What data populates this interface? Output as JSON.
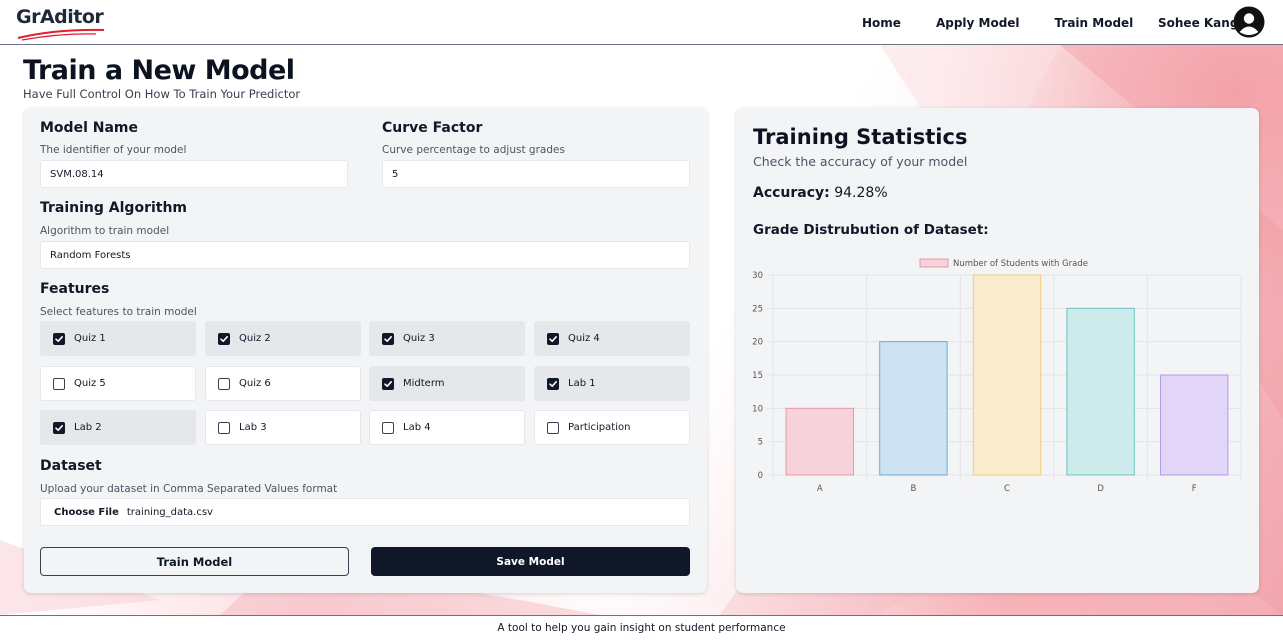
{
  "nav": {
    "logo_text": "GrAditor",
    "links": [
      "Home",
      "Apply Model",
      "Train Model"
    ],
    "user_name": "Sohee Kang"
  },
  "page": {
    "title": "Train a New Model",
    "subtitle": "Have Full Control On How To Train Your Predictor"
  },
  "form": {
    "model_name": {
      "label": "Model Name",
      "help": "The identifier of your model",
      "value": "SVM.08.14"
    },
    "curve_factor": {
      "label": "Curve Factor",
      "help": "Curve percentage to adjust grades",
      "value": "5"
    },
    "algorithm": {
      "label": "Training Algorithm",
      "help": "Algorithm to train model",
      "value": "Random Forests"
    },
    "features": {
      "label": "Features",
      "help": "Select features to train model",
      "items": [
        {
          "label": "Quiz 1",
          "checked": true
        },
        {
          "label": "Quiz 2",
          "checked": true
        },
        {
          "label": "Quiz 3",
          "checked": true
        },
        {
          "label": "Quiz 4",
          "checked": true
        },
        {
          "label": "Quiz 5",
          "checked": false
        },
        {
          "label": "Quiz 6",
          "checked": false
        },
        {
          "label": "Midterm",
          "checked": true
        },
        {
          "label": "Lab 1",
          "checked": true
        },
        {
          "label": "Lab 2",
          "checked": true
        },
        {
          "label": "Lab 3",
          "checked": false
        },
        {
          "label": "Lab 4",
          "checked": false
        },
        {
          "label": "Participation",
          "checked": false
        }
      ]
    },
    "dataset": {
      "label": "Dataset",
      "help": "Upload your dataset in Comma Separated Values format",
      "button": "Choose File",
      "file_name": "training_data.csv"
    },
    "train_button": "Train Model",
    "save_button": "Save Model"
  },
  "stats": {
    "title": "Training Statistics",
    "subtitle": "Check the accuracy of your model",
    "accuracy_label": "Accuracy:",
    "accuracy_value": "94.28%",
    "distribution_title": "Grade Distrubution of Dataset:"
  },
  "chart_data": {
    "type": "bar",
    "categories": [
      "A",
      "B",
      "C",
      "D",
      "F"
    ],
    "series": [
      {
        "name": "Number of Students with Grade",
        "values": [
          10,
          20,
          30,
          25,
          15
        ]
      }
    ],
    "bar_fill_colors": [
      "#f6d2da",
      "#cde3f3",
      "#faebcc",
      "#cdebea",
      "#e1d6f7"
    ],
    "bar_stroke_colors": [
      "#e896a8",
      "#6aaad6",
      "#f2cc7c",
      "#6cc3c0",
      "#b39ae9"
    ],
    "ylim": [
      0,
      30
    ],
    "yticks": [
      0,
      5,
      10,
      15,
      20,
      25,
      30
    ],
    "grid": true,
    "legend_position": "top"
  },
  "footer": {
    "text": "A tool to help you gain insight on student performance"
  }
}
